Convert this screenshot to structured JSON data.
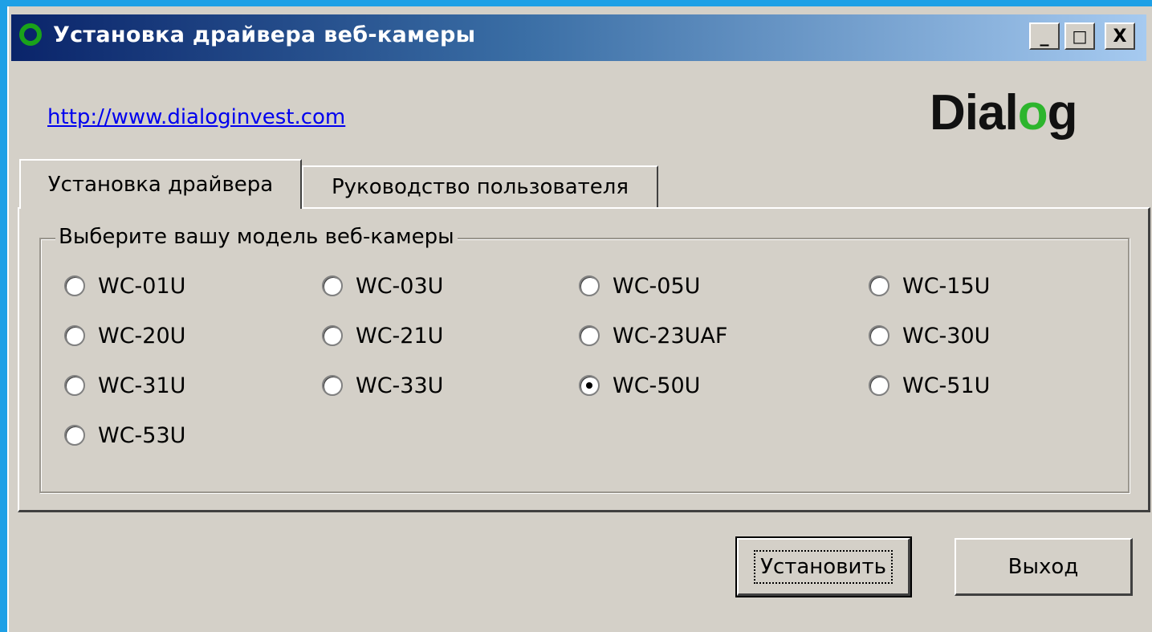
{
  "window": {
    "title": "Установка драйвера веб-камеры",
    "controls": {
      "minimize": "_",
      "maximize": "□",
      "close": "X"
    }
  },
  "header": {
    "link_text": "http://www.dialoginvest.com",
    "logo_part1": "Dial",
    "logo_o": "o",
    "logo_part2": "g"
  },
  "tabs": [
    {
      "label": "Установка драйвера",
      "active": true
    },
    {
      "label": "Руководство пользователя",
      "active": false
    }
  ],
  "groupbox": {
    "legend": "Выберите вашу модель веб-камеры",
    "models": [
      {
        "label": "WC-01U",
        "checked": false
      },
      {
        "label": "WC-03U",
        "checked": false
      },
      {
        "label": "WC-05U",
        "checked": false
      },
      {
        "label": "WC-15U",
        "checked": false
      },
      {
        "label": "WC-20U",
        "checked": false
      },
      {
        "label": "WC-21U",
        "checked": false
      },
      {
        "label": "WC-23UAF",
        "checked": false
      },
      {
        "label": "WC-30U",
        "checked": false
      },
      {
        "label": "WC-31U",
        "checked": false
      },
      {
        "label": "WC-33U",
        "checked": false
      },
      {
        "label": "WC-50U",
        "checked": true
      },
      {
        "label": "WC-51U",
        "checked": false
      },
      {
        "label": "WC-53U",
        "checked": false
      }
    ]
  },
  "buttons": {
    "install": "Установить",
    "exit": "Выход"
  },
  "colors": {
    "desktop": "#1ea0e6",
    "face": "#d4d0c8",
    "title_start": "#0a246a",
    "title_end": "#a6caf0",
    "logo_accent": "#2db52d",
    "link": "#0000ee"
  }
}
